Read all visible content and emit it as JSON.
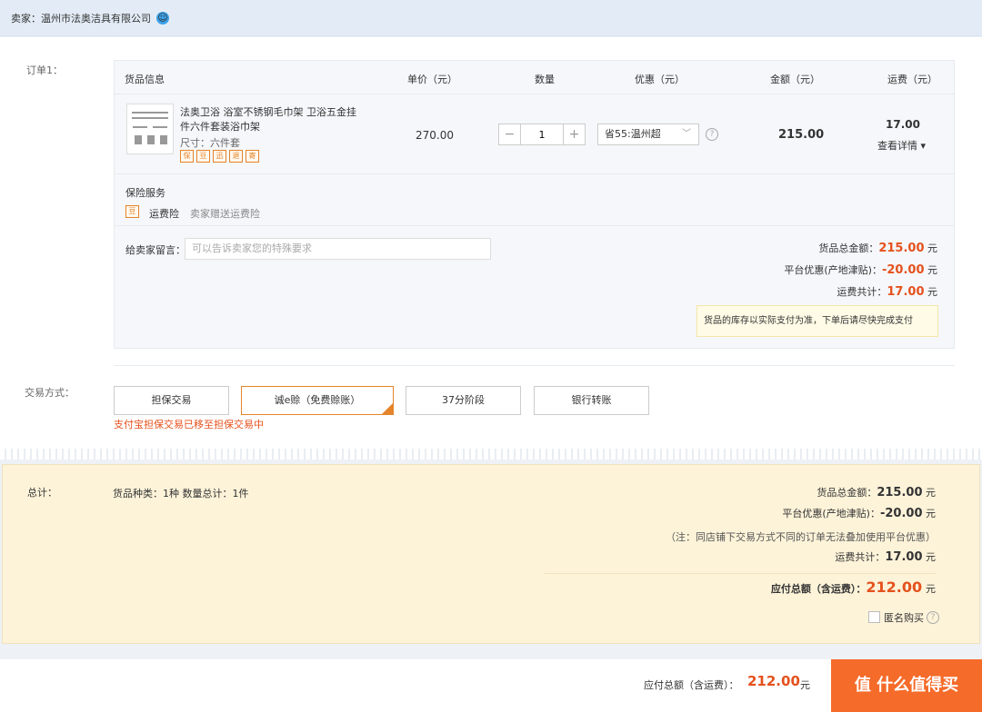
{
  "seller": {
    "label": "卖家：",
    "name": "温州市法奥洁具有限公司"
  },
  "order": {
    "label": "订单1：",
    "headers": [
      "货品信息",
      "单价（元）",
      "数量",
      "优惠（元）",
      "金额（元）",
      "运费（元）"
    ],
    "item": {
      "title": "法奥卫浴 浴室不锈钢毛巾架 卫浴五金挂件六件套装浴巾架",
      "spec": "尺寸：六件套",
      "badges": [
        "保",
        "豆",
        "迅",
        "退",
        "寄"
      ],
      "price": "270.00",
      "qty": "1",
      "promo": "省55:温州超",
      "amount": "215.00",
      "shipping": "17.00",
      "shipping_detail": "查看详情"
    },
    "insurance": {
      "title": "保险服务",
      "badge": "豆",
      "name": "运费险",
      "desc": "卖家赠送运费险"
    },
    "message": {
      "label": "给卖家留言：",
      "placeholder": "可以告诉卖家您的特殊要求"
    },
    "summary": {
      "goods_label": "货品总金额：",
      "goods_value": "215.00",
      "discount_label": "平台优惠(产地津贴)：",
      "discount_value": "-20.00",
      "shipping_label": "运费共计：",
      "shipping_value": "17.00",
      "unit": "元"
    },
    "notice": "货品的库存以实际支付为准，下单后请尽快完成支付"
  },
  "payment": {
    "label": "交易方式：",
    "options": [
      "担保交易",
      "诚e赊（免费赊账）",
      "37分阶段",
      "银行转账"
    ],
    "note": "支付宝担保交易已移至担保交易中"
  },
  "total": {
    "label": "总计：",
    "counts": "货品种类：1种   数量总计：1件",
    "goods_label": "货品总金额：",
    "goods_value": "215.00",
    "discount_label": "平台优惠(产地津贴)：",
    "discount_value": "-20.00",
    "note": "（注：同店铺下交易方式不同的订单无法叠加使用平台优惠）",
    "shipping_label": "运费共计：",
    "shipping_value": "17.00",
    "payable_label": "应付总额（含运费）：",
    "payable_value": "212.00",
    "unit": "元",
    "anonymous": "匿名购买"
  },
  "footer": {
    "payable_label": "应付总额（含运费）：",
    "payable_value": "212.00",
    "unit": "元",
    "submit": "值 什么值得买"
  }
}
